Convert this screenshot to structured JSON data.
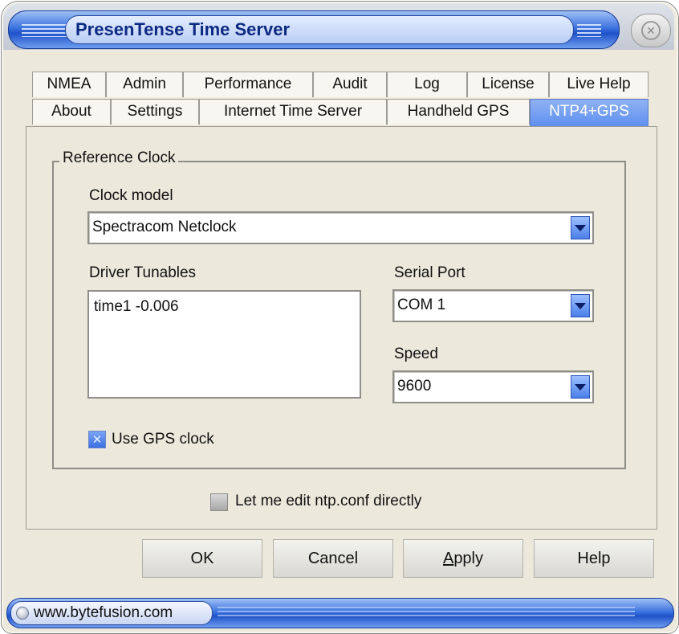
{
  "window": {
    "title": "PresenTense Time Server",
    "close_glyph": "✕"
  },
  "tabs": {
    "row1": [
      {
        "label": "NMEA"
      },
      {
        "label": "Admin"
      },
      {
        "label": "Performance"
      },
      {
        "label": "Audit"
      },
      {
        "label": "Log"
      },
      {
        "label": "License"
      },
      {
        "label": "Live Help"
      }
    ],
    "row2": [
      {
        "label": "About"
      },
      {
        "label": "Settings"
      },
      {
        "label": "Internet Time Server"
      },
      {
        "label": "Handheld GPS"
      },
      {
        "label": "NTP4+GPS",
        "active": true
      }
    ]
  },
  "reference_clock": {
    "group_label": "Reference Clock",
    "clock_model_label": "Clock model",
    "clock_model_value": "Spectracom Netclock",
    "driver_tunables_label": "Driver  Tunables",
    "driver_tunables_value": "time1 -0.006",
    "serial_port_label": "Serial Port",
    "serial_port_value": "COM 1",
    "speed_label": "Speed",
    "speed_value": "9600",
    "use_gps_label": "Use GPS clock",
    "use_gps_checked": true
  },
  "edit_ntp_conf": {
    "label": "Let me edit ntp.conf directly",
    "checked": false
  },
  "buttons": {
    "ok": "OK",
    "cancel": "Cancel",
    "apply_first": "A",
    "apply_rest": "pply",
    "help": "Help"
  },
  "statusbar": {
    "text": "www.bytefusion.com"
  },
  "colors": {
    "accent": "#3d73e0",
    "active_tab": "#6f9af0",
    "window_bg": "#ece9dc"
  },
  "icons": [
    "close-icon",
    "dropdown-arrow-icon",
    "checkbox-icon",
    "status-orb-icon"
  ]
}
